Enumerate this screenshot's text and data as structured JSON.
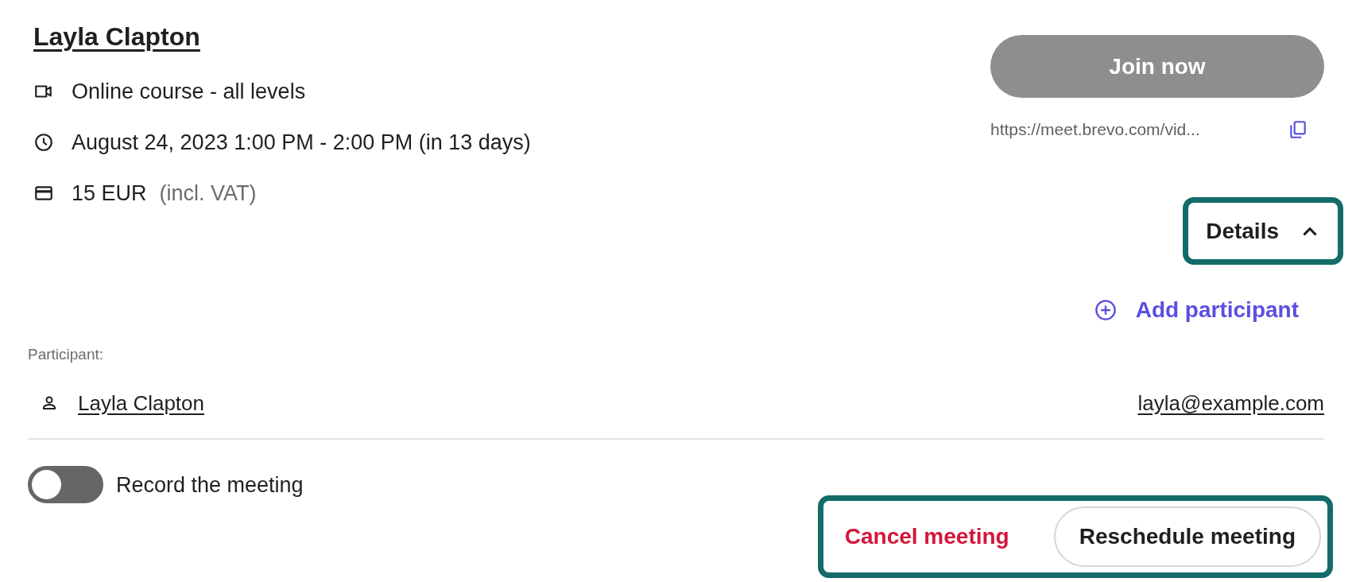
{
  "title": "Layla Clapton",
  "info": [
    {
      "kind": "video",
      "text": "Online course - all levels"
    },
    {
      "kind": "clock",
      "text": "August 24, 2023 1:00 PM - 2:00 PM (in 13 days)"
    },
    {
      "kind": "card",
      "text": "15 EUR",
      "note": "(incl. VAT)"
    }
  ],
  "join_button": {
    "label": "Join now",
    "disabled": true
  },
  "meeting_link": "https://meet.brevo.com/vid...",
  "details_toggle": {
    "label": "Details",
    "expanded": true,
    "highlighted": true
  },
  "add_participant": "Add participant",
  "participants_label": "Participant:",
  "participants": [
    {
      "name": "Layla Clapton",
      "email": "layla@example.com"
    }
  ],
  "record_toggle": {
    "label": "Record the meeting",
    "on": false
  },
  "actions": {
    "highlighted": true,
    "buttons": [
      {
        "kind": "danger",
        "label": "Cancel meeting"
      },
      {
        "kind": "outline",
        "label": "Reschedule meeting"
      }
    ]
  }
}
